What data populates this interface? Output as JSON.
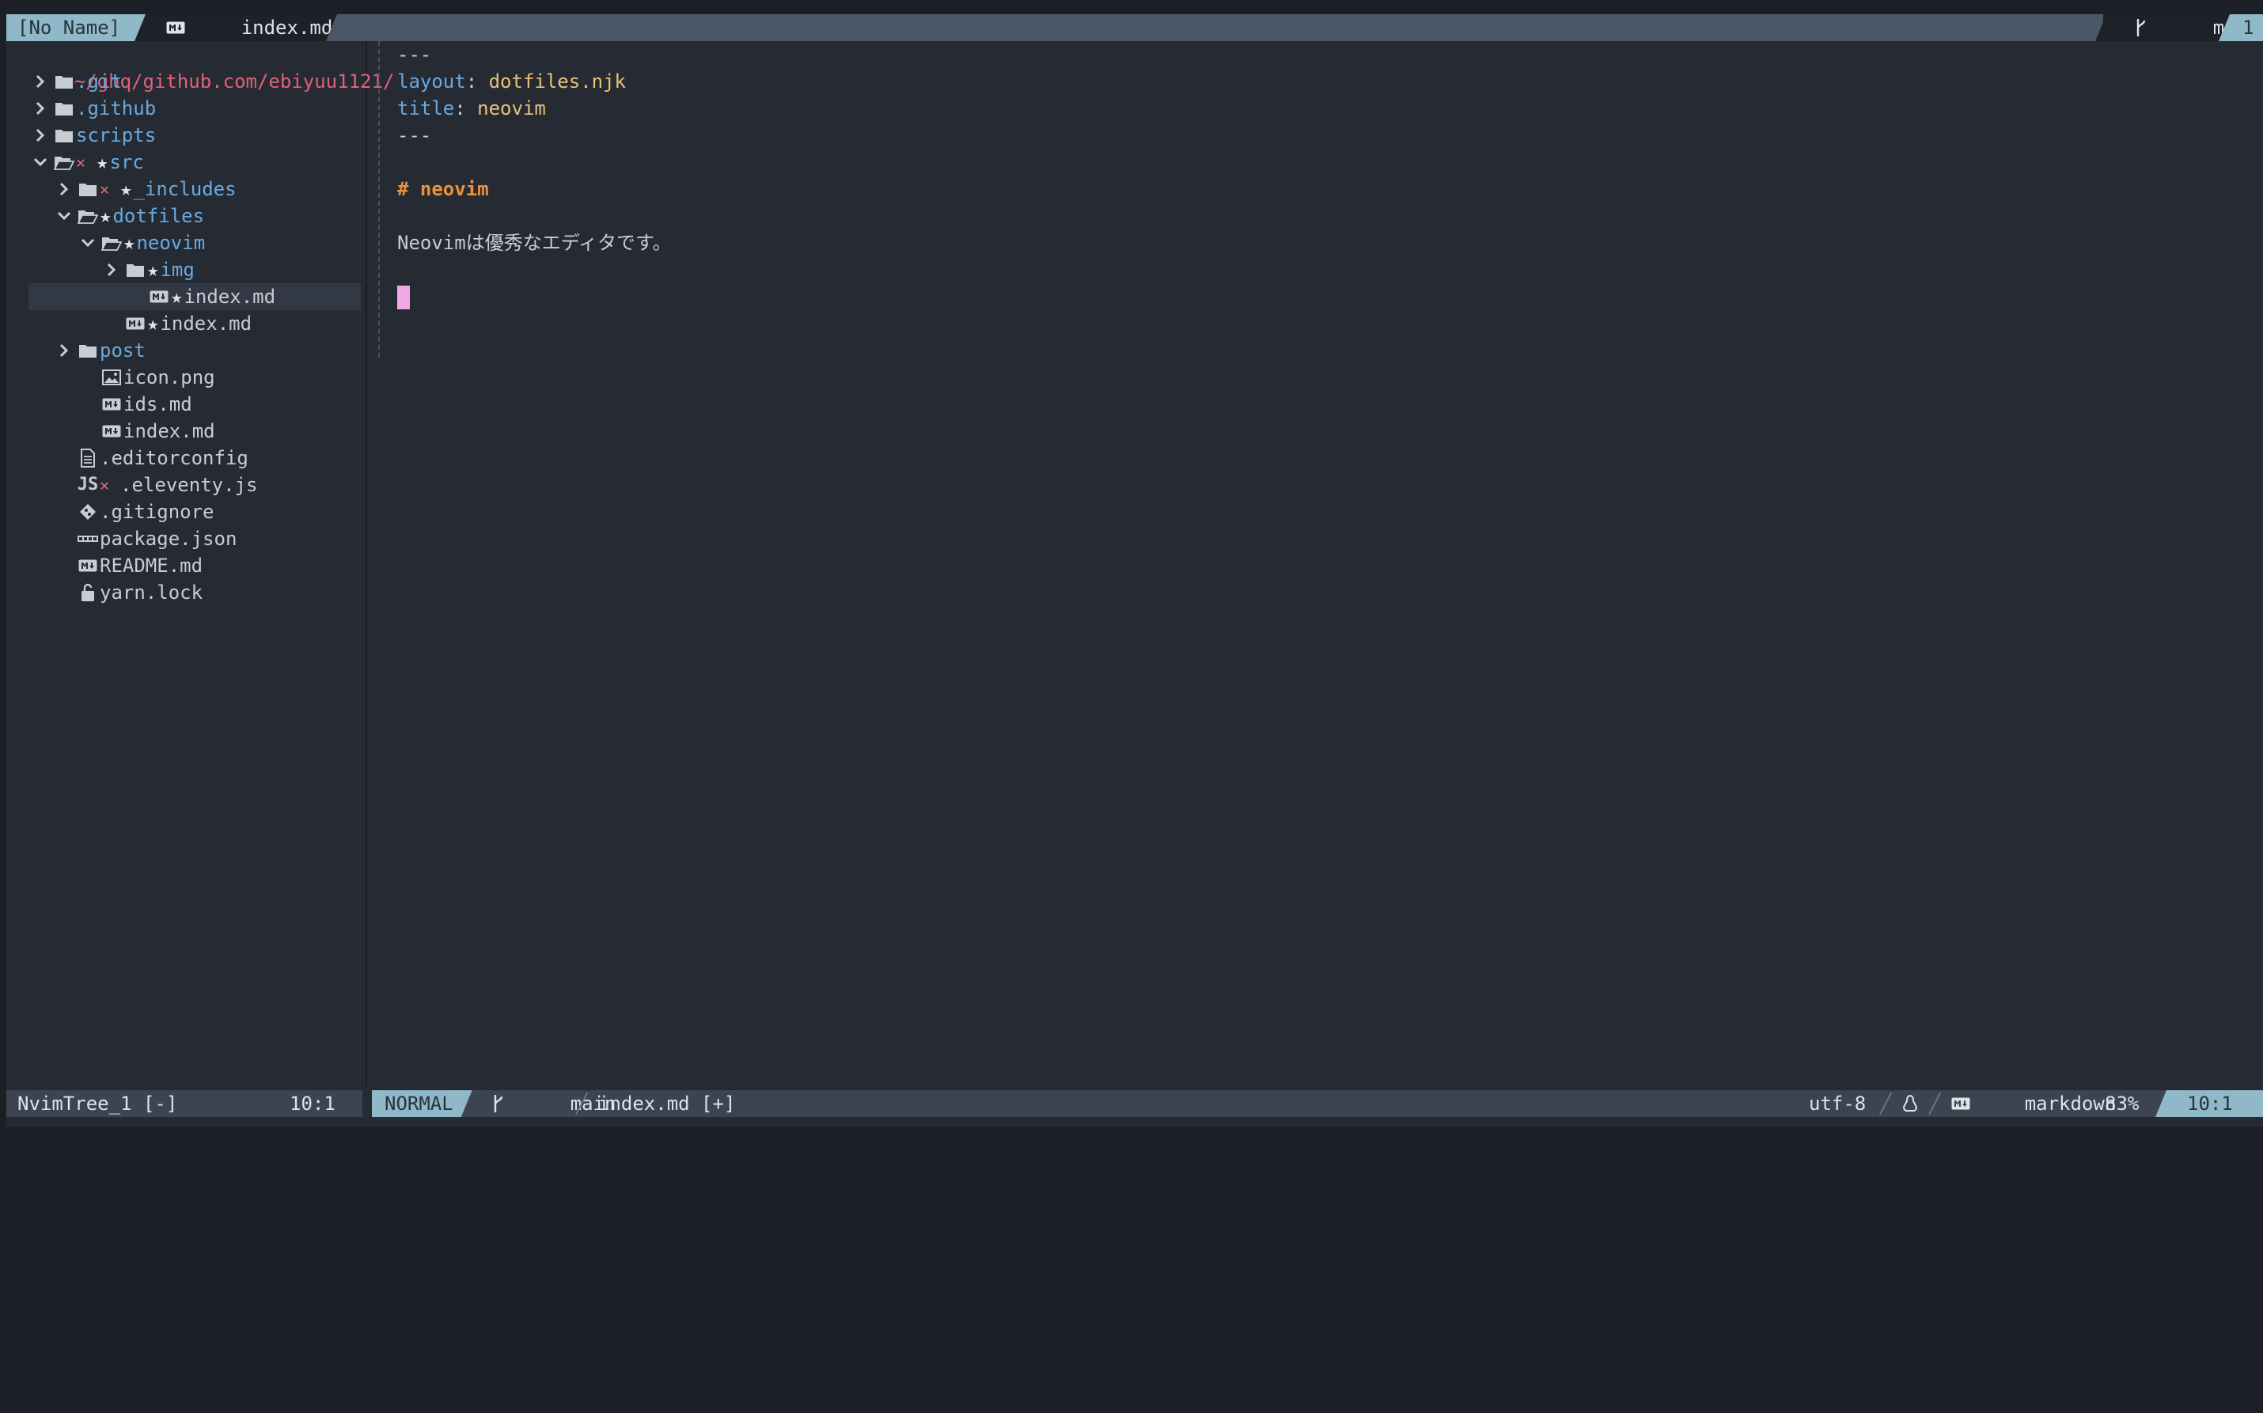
{
  "tabline": {
    "noname": "[No Name]",
    "active_file": "index.md[+]",
    "branch": "main",
    "tab_number": "1"
  },
  "tree": {
    "root": "~/ghq/github.com/ebiyuu1121/",
    "items": [
      {
        "label": ".git",
        "kind": "dir",
        "state": "collapsed",
        "depth": 0
      },
      {
        "label": ".github",
        "kind": "dir",
        "state": "collapsed",
        "depth": 0
      },
      {
        "label": "scripts",
        "kind": "dir",
        "state": "collapsed",
        "depth": 0
      },
      {
        "label": "src",
        "kind": "dir",
        "state": "expanded",
        "depth": 0,
        "marks": "x-star"
      },
      {
        "label": "_includes",
        "kind": "dir",
        "state": "collapsed",
        "depth": 1,
        "marks": "x-star"
      },
      {
        "label": "dotfiles",
        "kind": "dir",
        "state": "expanded",
        "depth": 1,
        "marks": "star"
      },
      {
        "label": "neovim",
        "kind": "dir",
        "state": "expanded",
        "depth": 2,
        "marks": "star"
      },
      {
        "label": "img",
        "kind": "dir",
        "state": "collapsed",
        "depth": 3,
        "marks": "star"
      },
      {
        "label": "index.md",
        "kind": "markdown",
        "depth": 4,
        "marks": "star",
        "selected": true
      },
      {
        "label": "index.md",
        "kind": "markdown",
        "depth": 3,
        "marks": "star"
      },
      {
        "label": "post",
        "kind": "dir",
        "state": "collapsed",
        "depth": 1
      },
      {
        "label": "icon.png",
        "kind": "image",
        "depth": 2
      },
      {
        "label": "ids.md",
        "kind": "markdown",
        "depth": 2
      },
      {
        "label": "index.md",
        "kind": "markdown",
        "depth": 2
      },
      {
        "label": ".editorconfig",
        "kind": "text",
        "depth": 1
      },
      {
        "label": ".eleventy.js",
        "kind": "js",
        "depth": 1,
        "marks": "x"
      },
      {
        "label": ".gitignore",
        "kind": "git",
        "depth": 1
      },
      {
        "label": "package.json",
        "kind": "npm",
        "depth": 1
      },
      {
        "label": "README.md",
        "kind": "markdown",
        "depth": 1
      },
      {
        "label": "yarn.lock",
        "kind": "lock",
        "depth": 1
      }
    ]
  },
  "editor": {
    "line1": "---",
    "layout_key": "layout",
    "layout_value": "dotfiles.njk",
    "title_key": "title",
    "title_value": "neovim",
    "line4": "---",
    "heading": "# neovim",
    "paragraph": "Neovimは優秀なエディタです。",
    "colon": ": "
  },
  "statusline": {
    "tree_name": "NvimTree_1 [-]",
    "tree_pos": "10:1",
    "mode": "NORMAL",
    "branch": "main",
    "file": "index.md [+]",
    "encoding": "utf-8",
    "filetype": "markdown",
    "percent": "83%",
    "position": "10:1"
  },
  "colors": {
    "background": "#262b33",
    "accent": "#8fb8c8",
    "directory": "#6aa9e0",
    "root_path": "#e0617a",
    "heading": "#e9923b",
    "yaml_value": "#e8c27a"
  }
}
